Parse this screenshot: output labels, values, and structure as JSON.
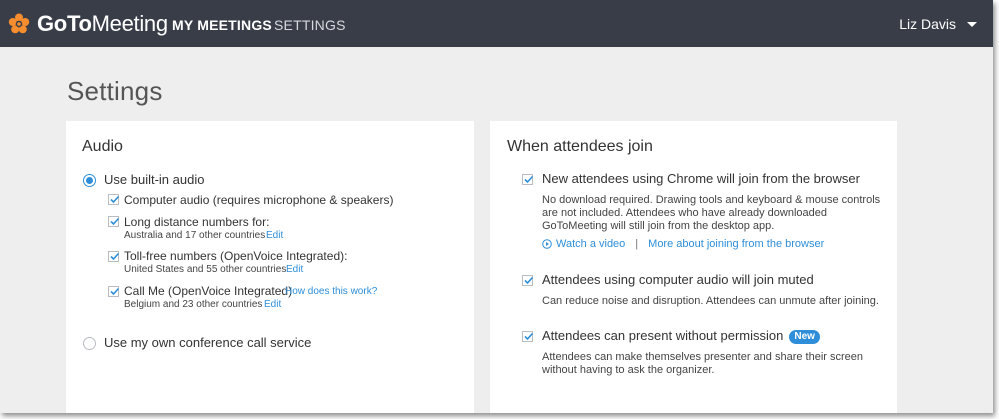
{
  "app": {
    "brand_part1": "GoTo",
    "brand_part2": "Meeting"
  },
  "nav": {
    "my_meetings": "MY MEETINGS",
    "settings": "SETTINGS"
  },
  "user": {
    "name": "Liz Davis"
  },
  "page": {
    "title": "Settings"
  },
  "audio": {
    "title": "Audio",
    "builtin_label": "Use built-in audio",
    "computer_audio": "Computer audio (requires microphone & speakers)",
    "long_distance": "Long distance numbers for:",
    "long_distance_sub": "Australia and 17 other countries",
    "toll_free": "Toll-free numbers (OpenVoice Integrated):",
    "toll_free_sub": "United States and 55 other countries",
    "call_me": "Call Me (OpenVoice Integrated)",
    "how_link": "How does this work?",
    "call_me_sub": "Belgium and 23 other countries",
    "edit": "Edit",
    "own_service": "Use my own conference call service"
  },
  "join": {
    "title": "When attendees join",
    "chrome_label": "New attendees using Chrome will join from the browser",
    "chrome_desc_1": "No download required. Drawing tools and keyboard & mouse controls",
    "chrome_desc_2": "are not included. Attendees who have already downloaded",
    "chrome_desc_3": "GoToMeeting will still join from the desktop app.",
    "watch_video": "Watch a video",
    "separator": "|",
    "more_link": "More about joining from the browser",
    "muted_label": "Attendees using computer audio will join muted",
    "muted_desc": "Can reduce noise and disruption. Attendees can unmute after joining.",
    "present_label": "Attendees can present without permission",
    "new_badge": "New",
    "present_desc_1": "Attendees can make themselves presenter and share their screen",
    "present_desc_2": "without having to ask the organizer."
  },
  "colors": {
    "topbar": "#383d48",
    "accent": "#2e8ed9",
    "logo_orange": "#f68d2e",
    "background": "#eeeeee"
  }
}
